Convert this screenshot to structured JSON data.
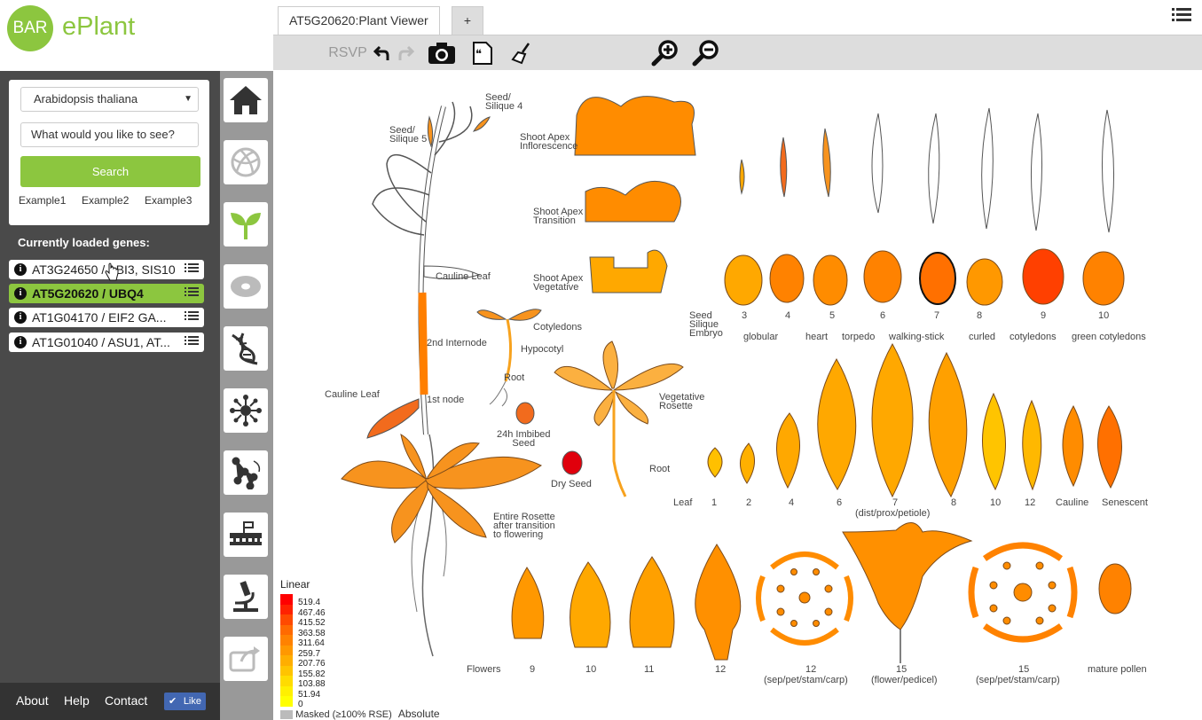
{
  "logo": {
    "badge": "BAR",
    "name": "ePlant"
  },
  "tabs": {
    "active": "AT5G20620:Plant Viewer",
    "add": "+"
  },
  "toolbar": {
    "rsvp": "RSVP"
  },
  "sidebar": {
    "species": "Arabidopsis thaliana",
    "search_placeholder": "What would you like to see?",
    "search_button": "Search",
    "examples": [
      "Example1",
      "Example2",
      "Example3"
    ],
    "loaded_label": "Currently loaded genes:",
    "genes": [
      {
        "label": "AT3G24650 / ABI3, SIS10",
        "active": false
      },
      {
        "label": "AT5G20620 / UBQ4",
        "active": true
      },
      {
        "label": "AT1G04170 / EIF2 GA...",
        "active": false
      },
      {
        "label": "AT1G01040 / ASU1, AT...",
        "active": false
      }
    ]
  },
  "footer": {
    "about": "About",
    "help": "Help",
    "contact": "Contact",
    "like": "Like"
  },
  "plant": {
    "seed_silique4": [
      "Seed/",
      "Silique 4"
    ],
    "seed_silique5": [
      "Seed/",
      "Silique 5"
    ],
    "shoot_apex_inf": [
      "Shoot Apex",
      "Inflorescence"
    ],
    "shoot_apex_tr": [
      "Shoot Apex",
      "Transition"
    ],
    "shoot_apex_veg": [
      "Shoot Apex",
      "Vegetative"
    ],
    "cauline_leaf_top": "Cauline Leaf",
    "cotyledons": "Cotyledons",
    "hypocotyl": "Hypocotyl",
    "root1": "Root",
    "internode": "2nd Internode",
    "cauline_leaf_low": "Cauline Leaf",
    "first_node": "1st node",
    "imbibed": [
      "24h Imbibed",
      "Seed"
    ],
    "dry_seed": "Dry Seed",
    "veg_rosette": [
      "Vegetative",
      "Rosette"
    ],
    "root2": "Root",
    "entire_rosette": [
      "Entire Rosette",
      "after transition",
      "to flowering"
    ],
    "seed_row_label": [
      "Seed",
      "Silique",
      "Embryo"
    ],
    "seed_nums": [
      "3",
      "4",
      "5",
      "6",
      "7",
      "8",
      "9",
      "10"
    ],
    "seed_stages": [
      "globular",
      "heart",
      "torpedo",
      "walking-stick",
      "curled",
      "cotyledons",
      "green cotyledons"
    ],
    "leaf_row": [
      "Leaf",
      "1",
      "2",
      "4",
      "6",
      "7",
      "8",
      "10",
      "12",
      "Cauline",
      "Senescent"
    ],
    "leaf_sub": "(dist/prox/petiole)",
    "flower_row": [
      "Flowers",
      "9",
      "10",
      "11",
      "12",
      "12",
      "15",
      "15",
      "mature pollen"
    ],
    "flower_sub": [
      "(sep/pet/stam/carp)",
      "(flower/pedicel)",
      "(sep/pet/stam/carp)"
    ]
  },
  "legend": {
    "title": "Linear",
    "values": [
      "519.4",
      "467.46",
      "415.52",
      "363.58",
      "311.64",
      "259.7",
      "207.76",
      "155.82",
      "103.88",
      "51.94",
      "0"
    ],
    "colors": [
      "#ff0000",
      "#ff2200",
      "#ff4a00",
      "#ff6a00",
      "#ff8200",
      "#ff9800",
      "#ffae00",
      "#ffc400",
      "#ffdc00",
      "#fff000",
      "#ffff00"
    ],
    "masked": "Masked (≥100% RSE)",
    "mode": "Absolute"
  },
  "colors": {
    "brand": "#8cc63f",
    "dark": "#4a4a4a"
  }
}
